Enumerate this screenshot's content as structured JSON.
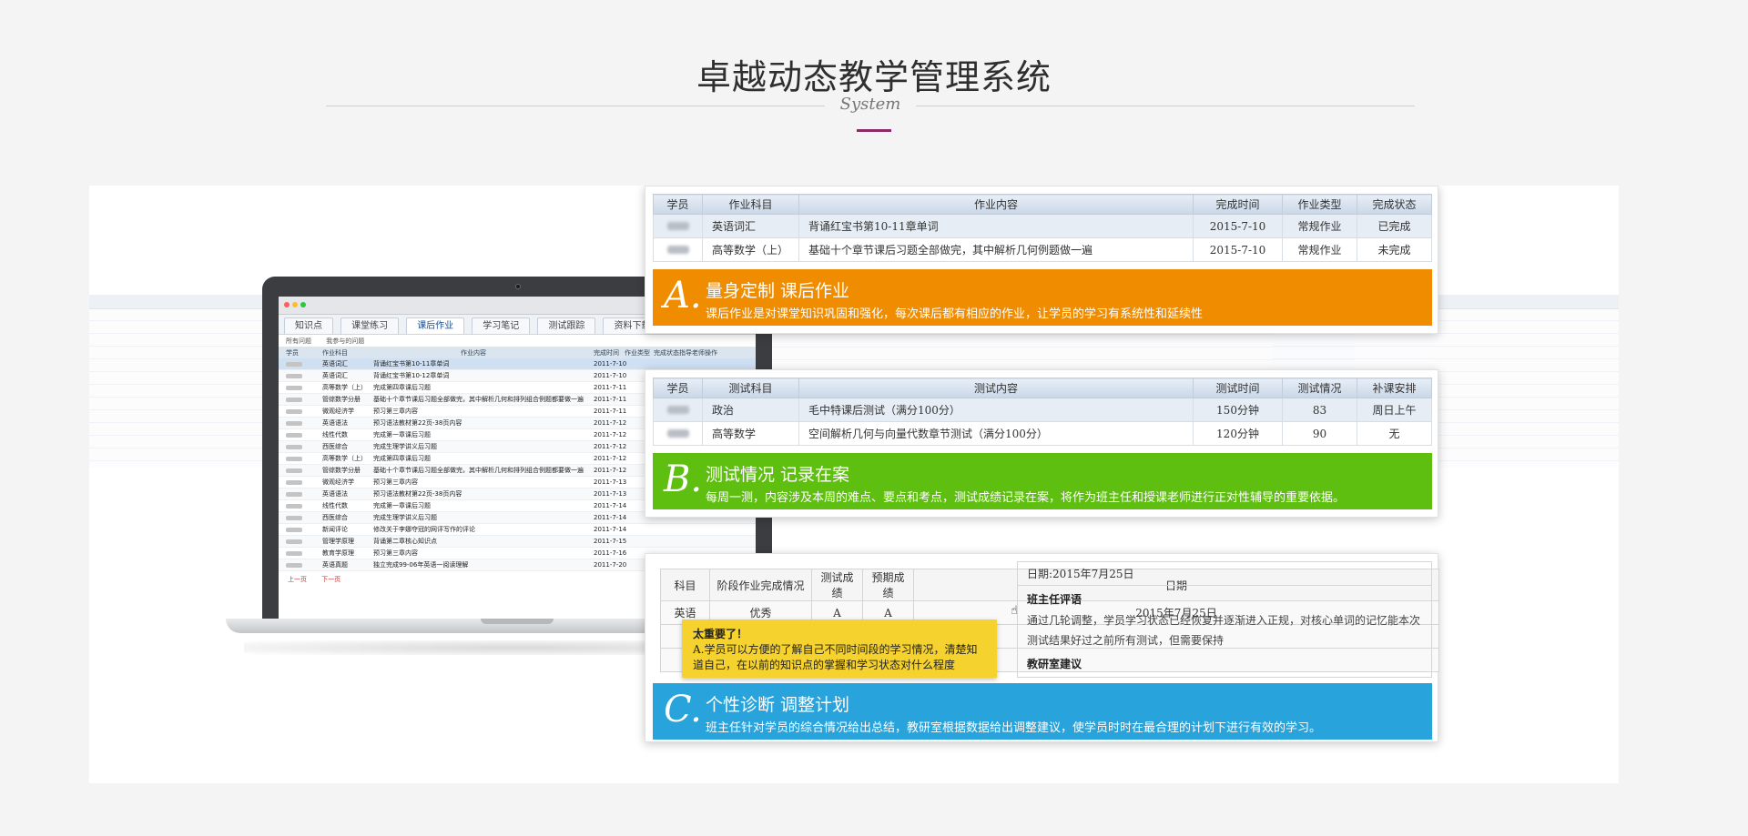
{
  "header": {
    "title": "卓越动态教学管理系统",
    "subtitle": "System"
  },
  "colors": {
    "accent": "#8c2a6a",
    "card_a": "#f08c00",
    "card_b": "#5fbf11",
    "card_c": "#28a3dc"
  },
  "laptop": {
    "tabs": [
      "知识点",
      "课堂练习",
      "课后作业",
      "学习笔记",
      "测试跟踪",
      "资料下载"
    ],
    "sub_tabs": [
      "所有问题",
      "我参与的问题"
    ],
    "columns": [
      "学员",
      "作业科目",
      "作业内容",
      "完成时间",
      "作业类型",
      "完成状态",
      "指导老师",
      "操作"
    ],
    "rows": [
      {
        "subject": "英语词汇",
        "content": "背诵红宝书第10-11章单词",
        "date": "2011-7-10"
      },
      {
        "subject": "英语词汇",
        "content": "背诵红宝书第10-12章单词",
        "date": "2011-7-10"
      },
      {
        "subject": "高等数学（上）",
        "content": "完成第四章课后习题",
        "date": "2011-7-11"
      },
      {
        "subject": "管综数学分册",
        "content": "基础十个章节课后习题全部做完，其中解析几何和排列组合例题都要做一遍",
        "date": "2011-7-11"
      },
      {
        "subject": "微观经济学",
        "content": "预习第三章内容",
        "date": "2011-7-11"
      },
      {
        "subject": "英语语法",
        "content": "预习语法教材第22页-38页内容",
        "date": "2011-7-12"
      },
      {
        "subject": "线性代数",
        "content": "完成第一章课后习题",
        "date": "2011-7-12"
      },
      {
        "subject": "西医综合",
        "content": "完成生理学讲义后习题",
        "date": "2011-7-12"
      },
      {
        "subject": "高等数学（上）",
        "content": "完成第四章课后习题",
        "date": "2011-7-12"
      },
      {
        "subject": "管综数学分册",
        "content": "基础十个章节课后习题全部做完，其中解析几何和排列组合例题都要做一遍",
        "date": "2011-7-12"
      },
      {
        "subject": "微观经济学",
        "content": "预习第三章内容",
        "date": "2011-7-13"
      },
      {
        "subject": "英语语法",
        "content": "预习语法教材第22页-38页内容",
        "date": "2011-7-13"
      },
      {
        "subject": "线性代数",
        "content": "完成第一章课后习题",
        "date": "2011-7-14"
      },
      {
        "subject": "西医综合",
        "content": "完成生理学讲义后习题",
        "date": "2011-7-14"
      },
      {
        "subject": "新闻评论",
        "content": "修改关于李娜夺冠的网评写作的评论",
        "date": "2011-7-14"
      },
      {
        "subject": "管理学原理",
        "content": "背诵第二章核心知识点",
        "date": "2011-7-15"
      },
      {
        "subject": "教育学原理",
        "content": "预习第三章内容",
        "date": "2011-7-16"
      },
      {
        "subject": "英语真题",
        "content": "独立完成99-06年英语一阅读理解",
        "date": "2011-7-20"
      }
    ],
    "pager": [
      "上一页",
      "下一页"
    ]
  },
  "card_a": {
    "columns": [
      "学员",
      "作业科目",
      "作业内容",
      "完成时间",
      "作业类型",
      "完成状态"
    ],
    "rows": [
      {
        "subject": "英语词汇",
        "content": "背诵红宝书第10-11章单词",
        "date": "2015-7-10",
        "type": "常规作业",
        "status": "已完成"
      },
      {
        "subject": "高等数学（上）",
        "content": "基础十个章节课后习题全部做完，其中解析几何例题做一遍",
        "date": "2015-7-10",
        "type": "常规作业",
        "status": "未完成"
      }
    ],
    "banner": {
      "letter": "A.",
      "title": "量身定制 课后作业",
      "desc": "课后作业是对课堂知识巩固和强化，每次课后都有相应的作业，让学员的学习有系统性和延续性"
    }
  },
  "card_b": {
    "columns": [
      "学员",
      "测试科目",
      "测试内容",
      "测试时间",
      "测试情况",
      "补课安排"
    ],
    "rows": [
      {
        "subject": "政治",
        "content": "毛中特课后测试（满分100分）",
        "time": "150分钟",
        "score": "83",
        "plan": "周日上午"
      },
      {
        "subject": "高等数学",
        "content": "空间解析几何与向量代数章节测试（满分100分）",
        "time": "120分钟",
        "score": "90",
        "plan": "无"
      }
    ],
    "banner": {
      "letter": "B.",
      "title": "测试情况  记录在案",
      "desc": "每周一测，内容涉及本周的难点、要点和考点，测试成绩记录在案，将作为班主任和授课老师进行正对性辅导的重要依据。"
    }
  },
  "card_c": {
    "columns": [
      "科目",
      "阶段作业完成情况",
      "测试成绩",
      "预期成绩",
      "日期"
    ],
    "row": {
      "subject": "英语",
      "status": "优秀",
      "score": "A",
      "expected": "A",
      "date": "2015年7月25日"
    },
    "date_label": "日期:2015年7月25日",
    "comment_heading": "班主任评语",
    "comment": "通过几轮调整，学员学习状态已经恢复并逐渐进入正规，对核心单词的记忆能本次测试结果好过之前所有测试，但需要保持",
    "advice_heading": "教研室建议",
    "note_title": "太重要了！",
    "note_text": "A.学员可以方便的了解自己不同时间段的学习情况，清楚知道自己，在以前的知识点的掌握和学习状态对什么程度",
    "banner": {
      "letter": "C.",
      "title": "个性诊断  调整计划",
      "desc": "班主任针对学员的综合情况给出总结，教研室根据数据给出调整建议，使学员时时在最合理的计划下进行有效的学习。"
    }
  }
}
